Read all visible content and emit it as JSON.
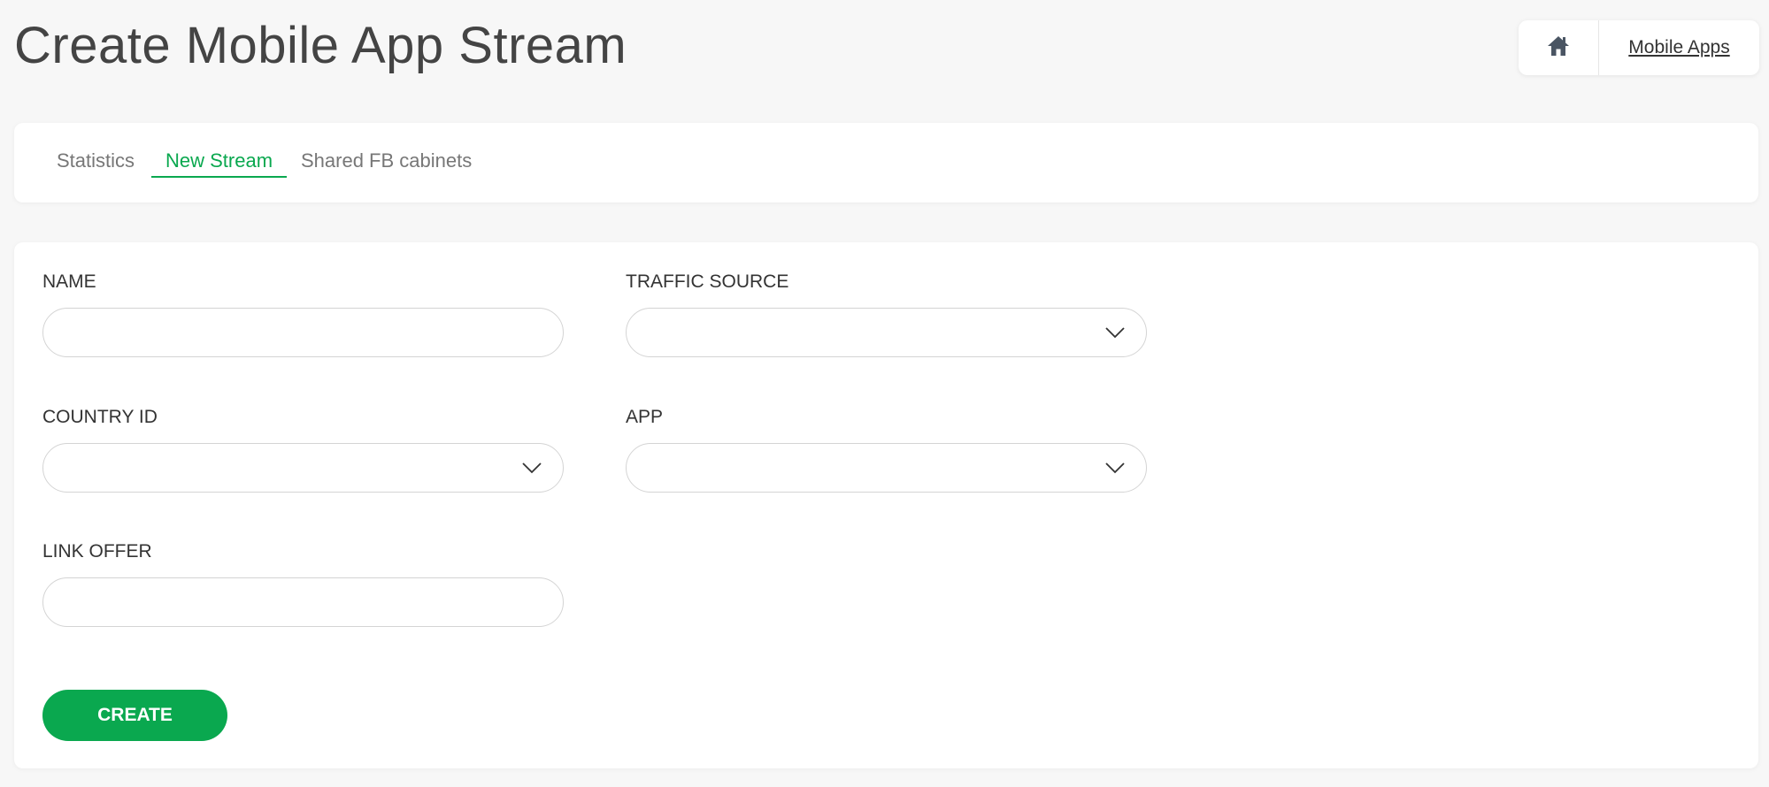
{
  "header": {
    "title": "Create Mobile App Stream"
  },
  "breadcrumb": {
    "home_icon": "home-icon",
    "link_label": "Mobile Apps"
  },
  "tabs": [
    {
      "label": "Statistics",
      "active": false
    },
    {
      "label": "New Stream",
      "active": true
    },
    {
      "label": "Shared FB cabinets",
      "active": false
    }
  ],
  "form": {
    "name": {
      "label": "NAME",
      "value": ""
    },
    "traffic_source": {
      "label": "TRAFFIC SOURCE",
      "value": ""
    },
    "country_id": {
      "label": "COUNTRY ID",
      "value": ""
    },
    "app": {
      "label": "APP",
      "value": ""
    },
    "link_offer": {
      "label": "LINK OFFER",
      "value": ""
    },
    "submit_label": "CREATE"
  },
  "colors": {
    "accent": "#0aa84f",
    "background": "#f7f7f7",
    "card": "#ffffff"
  }
}
